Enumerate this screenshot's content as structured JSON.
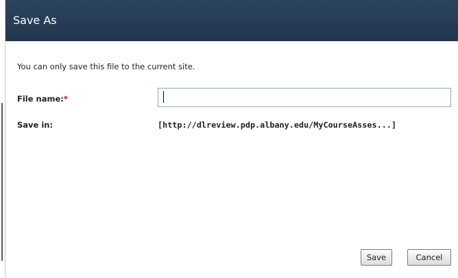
{
  "dialog": {
    "title": "Save As",
    "intro_text": "You can only save this file to the current site.",
    "file_name_label": "File name:",
    "required_marker": "*",
    "file_name_value": "",
    "save_in_label": "Save in:",
    "save_in_value": "[http://dlreview.pdp.albany.edu/MyCourseAsses...]",
    "save_button_label": "Save",
    "cancel_button_label": "Cancel"
  },
  "colors": {
    "titlebar": "#2c4460",
    "required": "#cc0000",
    "input_border": "#8aa8c8"
  }
}
